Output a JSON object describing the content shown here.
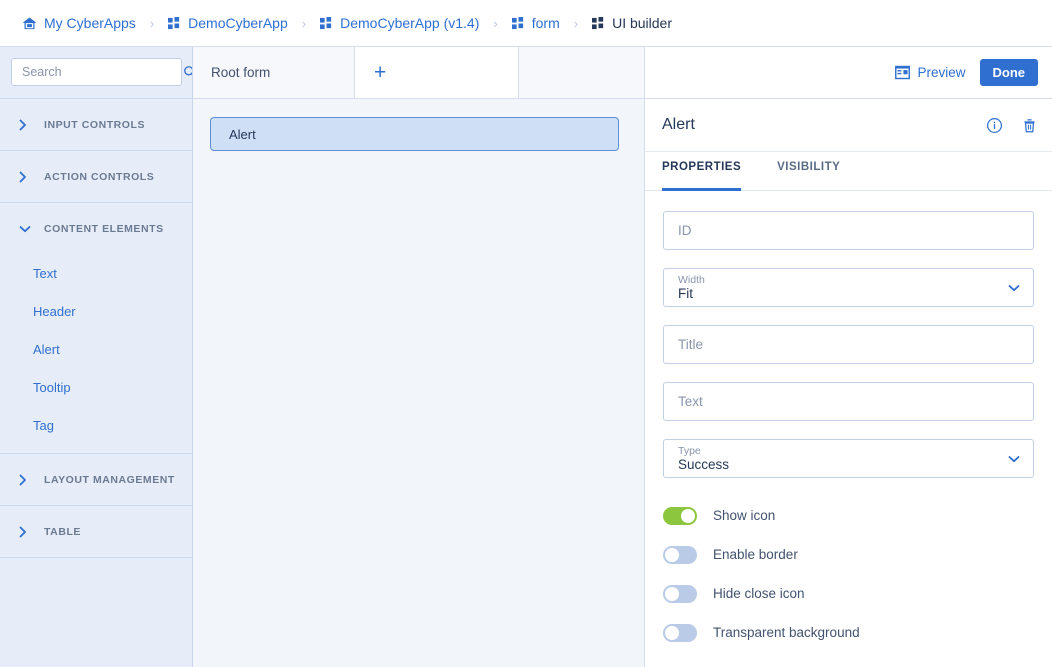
{
  "breadcrumb": {
    "items": [
      {
        "label": "My CyberApps",
        "icon": "home-icon",
        "current": false
      },
      {
        "label": "DemoCyberApp",
        "icon": "grid-icon",
        "current": false
      },
      {
        "label": "DemoCyberApp (v1.4)",
        "icon": "grid-icon",
        "current": false
      },
      {
        "label": "form",
        "icon": "grid-icon",
        "current": false
      },
      {
        "label": "UI builder",
        "icon": "grid-icon",
        "current": true
      }
    ],
    "separator": "›"
  },
  "sidebar": {
    "search": {
      "placeholder": "Search",
      "value": "",
      "icon": "search-icon"
    },
    "sections": [
      {
        "label": "INPUT CONTROLS",
        "expanded": false,
        "items": []
      },
      {
        "label": "ACTION CONTROLS",
        "expanded": false,
        "items": []
      },
      {
        "label": "CONTENT ELEMENTS",
        "expanded": true,
        "items": [
          "Text",
          "Header",
          "Alert",
          "Tooltip",
          "Tag"
        ]
      },
      {
        "label": "LAYOUT MANAGEMENT",
        "expanded": false,
        "items": []
      },
      {
        "label": "TABLE",
        "expanded": false,
        "items": []
      }
    ]
  },
  "center": {
    "tabs": [
      {
        "label": "Root form",
        "active": true
      },
      {
        "label": "+",
        "active": false
      }
    ],
    "canvas": {
      "widgets": [
        {
          "label": "Alert",
          "selected": true
        }
      ]
    }
  },
  "right_panel": {
    "preview_label": "Preview",
    "preview_icon": "layout-icon",
    "done_label": "Done",
    "title": "Alert",
    "info_icon": "info-icon",
    "delete_icon": "trash-icon",
    "tabs": [
      {
        "label": "PROPERTIES",
        "active": true
      },
      {
        "label": "VISIBILITY",
        "active": false
      }
    ],
    "fields": {
      "id": {
        "placeholder": "ID",
        "value": ""
      },
      "width": {
        "label": "Width",
        "value": "Fit"
      },
      "title": {
        "placeholder": "Title",
        "value": ""
      },
      "text": {
        "placeholder": "Text",
        "value": ""
      },
      "type": {
        "label": "Type",
        "value": "Success"
      }
    },
    "toggles": [
      {
        "label": "Show icon",
        "on": true
      },
      {
        "label": "Enable border",
        "on": false
      },
      {
        "label": "Hide close icon",
        "on": false
      },
      {
        "label": "Transparent background",
        "on": false
      }
    ]
  },
  "colors": {
    "accent": "#2f6fd0",
    "toggle_on": "#8cc63f",
    "toggle_off": "#b9cbe6",
    "sidebar_bg": "#e7edf8",
    "canvas_bg": "#f2f5fa"
  }
}
